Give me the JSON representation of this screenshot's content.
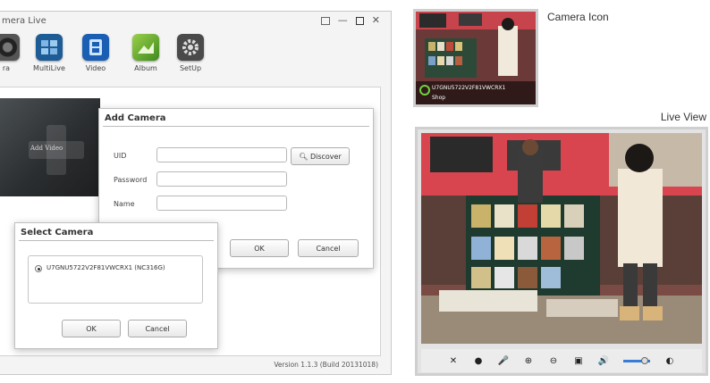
{
  "app": {
    "title": "mera Live",
    "window_controls": {
      "minimize": "—",
      "close": "✕"
    },
    "toolbar": [
      {
        "label": "ra",
        "icon": "camera-icon"
      },
      {
        "label": "MultiLive",
        "icon": "multilive-icon"
      },
      {
        "label": "Video",
        "icon": "video-icon"
      },
      {
        "label": "Album",
        "icon": "album-icon"
      },
      {
        "label": "SetUp",
        "icon": "setup-icon"
      }
    ],
    "preview_label": "Add Video",
    "version": "Version 1.1.3 (Build 20131018)"
  },
  "add_camera": {
    "title": "Add Camera",
    "uid_label": "UID",
    "password_label": "Password",
    "name_label": "Name",
    "discover_label": "Discover",
    "ok_label": "OK",
    "cancel_label": "Cancel"
  },
  "select_camera": {
    "title": "Select Camera",
    "option": "U7GNU5722V2F81VWCRX1 (NC316G)",
    "ok_label": "OK",
    "cancel_label": "Cancel"
  },
  "thumbnail": {
    "caption": "Camera Icon",
    "overlay_uid": "U7GNU5722V2F81VWCRX1",
    "overlay_name": "Shop"
  },
  "live_view": {
    "caption": "Live View",
    "controls": [
      "✕",
      "●",
      "🎤",
      "⊕",
      "⊖",
      "▣",
      "🔊",
      "◐"
    ]
  },
  "colors": {
    "accent_blue": "#3a7bd5",
    "window_bg": "#f4f4f4",
    "wall_red": "#d9454f"
  }
}
